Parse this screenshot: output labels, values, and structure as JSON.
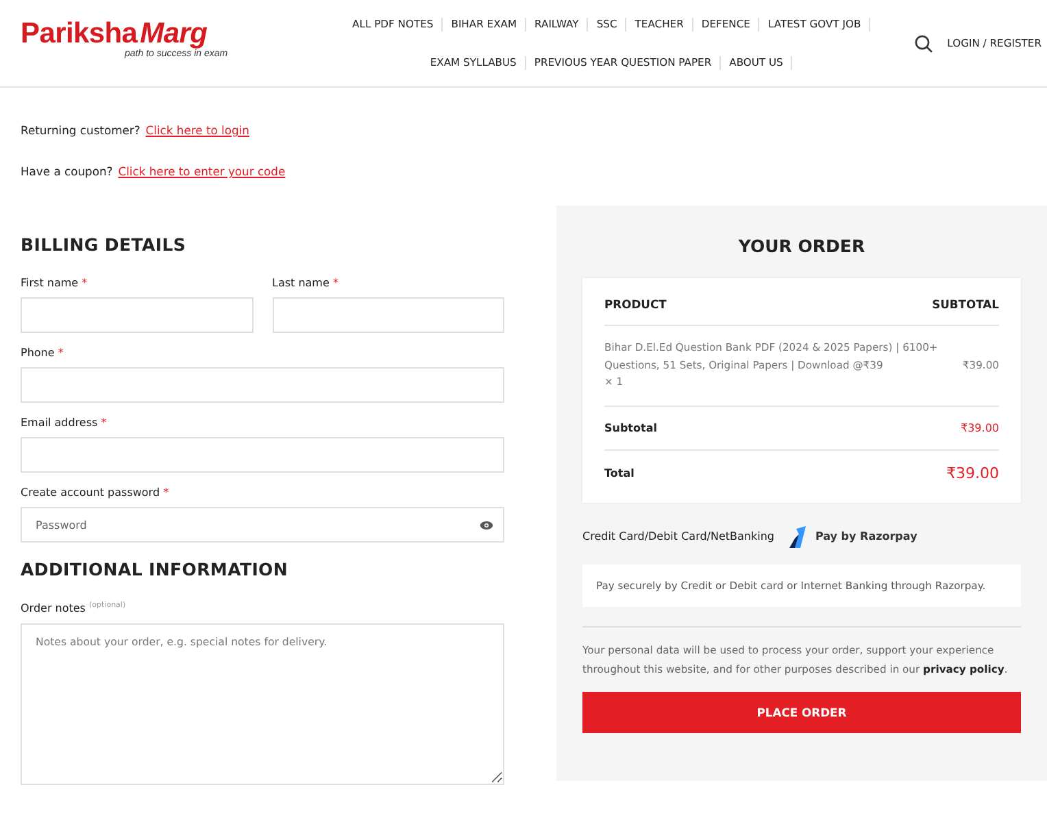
{
  "header": {
    "logo": {
      "word_1": "Pariksha",
      "word_2": "Marg",
      "tagline": "path to success in exam"
    },
    "nav_rows": [
      [
        "ALL PDF NOTES",
        "BIHAR EXAM",
        "RAILWAY",
        "SSC",
        "TEACHER",
        "DEFENCE",
        "LATEST GOVT JOB"
      ],
      [
        "EXAM SYLLABUS",
        "PREVIOUS YEAR QUESTION PAPER",
        "ABOUT US"
      ]
    ],
    "login": "LOGIN / REGISTER"
  },
  "notices": [
    {
      "text": "Returning customer?",
      "link": "Click here to login"
    },
    {
      "text": "Have a coupon?",
      "link": "Click here to enter your code"
    }
  ],
  "billing": {
    "title": "BILLING DETAILS",
    "rows": [
      [
        {
          "kind": "text",
          "label": "First name",
          "mark": "*"
        },
        {
          "kind": "text",
          "label": "Last name",
          "mark": "*"
        }
      ],
      [
        {
          "kind": "text",
          "label": "Phone",
          "mark": "*"
        }
      ],
      [
        {
          "kind": "text",
          "label": "Email address",
          "mark": "*"
        }
      ],
      [
        {
          "kind": "password",
          "label": "Create account password",
          "mark": "*",
          "placeholder": "Password"
        }
      ]
    ]
  },
  "additional": {
    "title": "ADDITIONAL INFORMATION",
    "label": "Order notes",
    "note": "(optional)",
    "placeholder": "Notes about your order, e.g. special notes for delivery."
  },
  "order": {
    "title": "YOUR ORDER",
    "columns": [
      "PRODUCT",
      "SUBTOTAL"
    ],
    "items": [
      {
        "name": "Bihar D.El.Ed Question Bank PDF (2024 & 2025 Papers) | 6100+ Questions, 51 Sets, Original Papers | Download @₹39",
        "qty": "× 1",
        "price": "₹39.00"
      }
    ],
    "subtotal": {
      "label": "Subtotal",
      "value": "₹39.00"
    },
    "total": {
      "label": "Total",
      "value": "₹39.00"
    },
    "payment": {
      "label": "Credit Card/Debit Card/NetBanking",
      "provider": "Pay by Razorpay",
      "description": "Pay securely by Credit or Debit card or Internet Banking through Razorpay."
    },
    "privacy": {
      "text": "Your personal data will be used to process your order, support your experience throughout this website, and for other purposes described in our",
      "link": "privacy policy",
      "end": "."
    },
    "button": "PLACE ORDER"
  }
}
